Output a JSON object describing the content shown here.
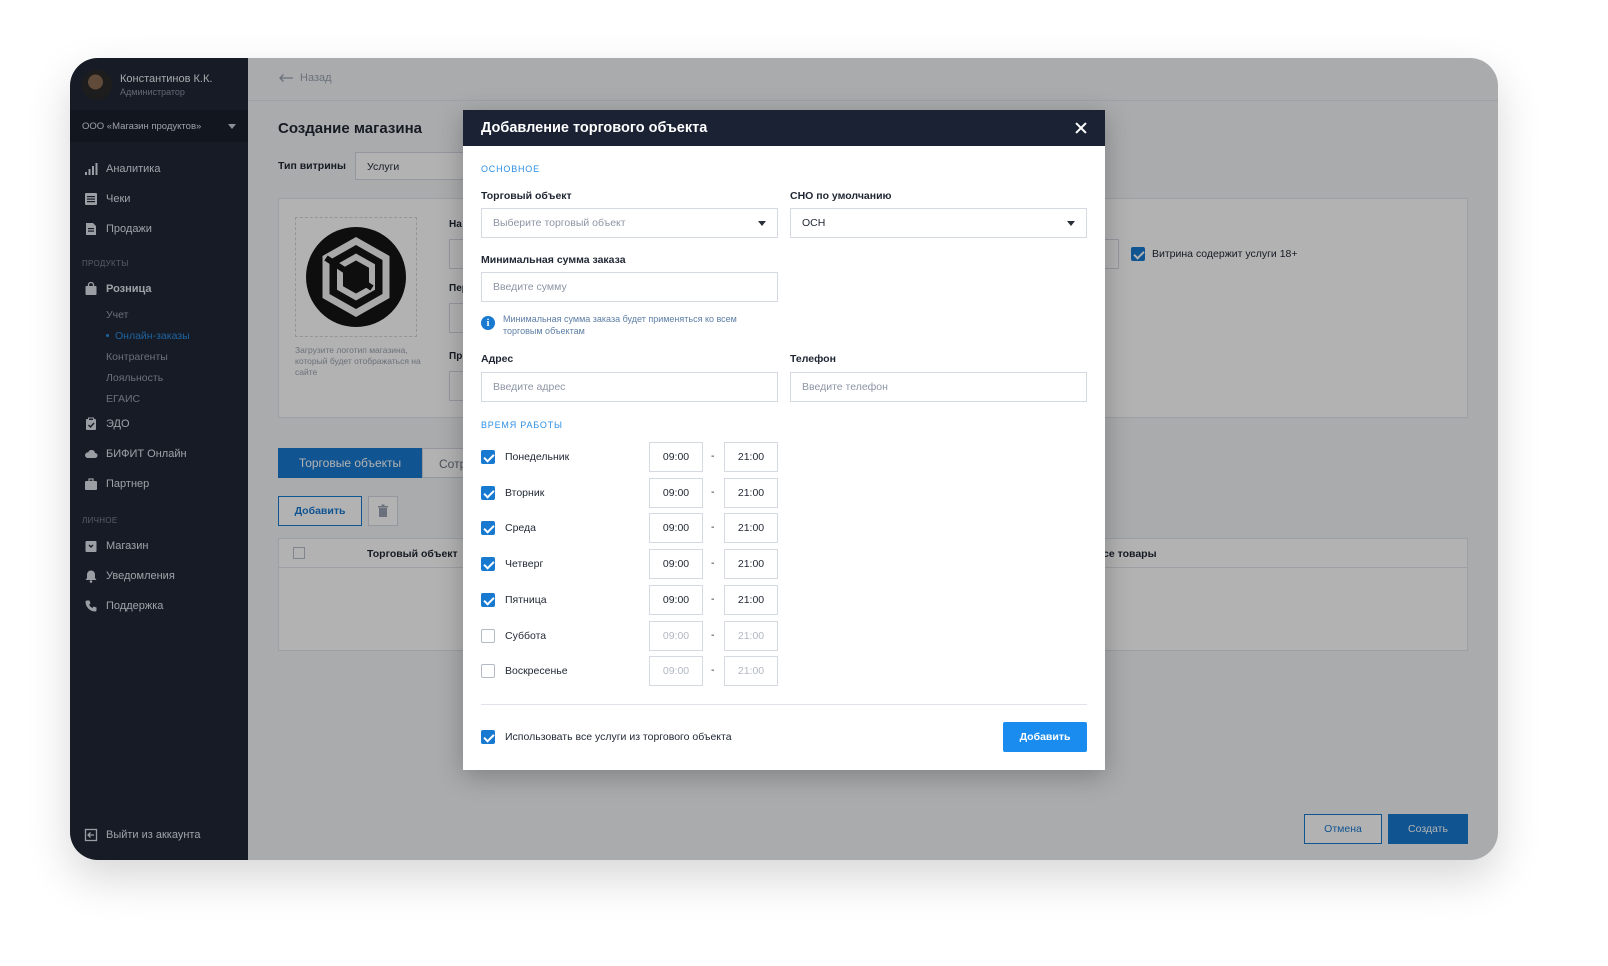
{
  "sidebar": {
    "user_name": "Константинов К.К.",
    "user_role": "Администратор",
    "org": "ООО «Магазин продуктов»",
    "items_top": [
      {
        "label": "Аналитика",
        "icon": "chart-bars-icon"
      },
      {
        "label": "Чеки",
        "icon": "receipt-icon"
      },
      {
        "label": "Продажи",
        "icon": "document-icon"
      }
    ],
    "section_products": "ПРОДУКТЫ",
    "retail": "Розница",
    "retail_sub": [
      "Учет",
      "Онлайн-заказы",
      "Контрагенты",
      "Лояльность",
      "ЕГАИС"
    ],
    "items_mid": [
      {
        "label": "ЭДО",
        "icon": "clipboard-icon"
      },
      {
        "label": "БИФИТ Онлайн",
        "icon": "cloud-icon"
      },
      {
        "label": "Партнер",
        "icon": "briefcase-icon"
      }
    ],
    "section_personal": "ЛИЧНОЕ",
    "items_personal": [
      {
        "label": "Магазин",
        "icon": "store-icon"
      },
      {
        "label": "Уведомления",
        "icon": "bell-icon"
      },
      {
        "label": "Поддержка",
        "icon": "phone-icon"
      }
    ],
    "logout": "Выйти из аккаунта"
  },
  "main": {
    "back": "Назад",
    "title": "Создание магазина",
    "vitrina_label": "Тип витрины",
    "vitrina_value": "Услуги",
    "logo_hint": "Загрузите логотип магазина, который будет отображаться на сайте",
    "frag_labels": [
      "На",
      "Пер",
      "Пр"
    ],
    "age_label": "Витрина содержит услуги 18+",
    "tab_active": "Торговые объекты",
    "tab_2": "Сотр",
    "add_button": "Добавить",
    "col_object": "Торговый объект",
    "col_goods": "се товары",
    "cancel": "Отмена",
    "create": "Создать"
  },
  "modal": {
    "title": "Добавление торгового объекта",
    "section_main": "ОСНОВНОЕ",
    "object_label": "Торговый объект",
    "object_placeholder": "Выберите торговый объект",
    "sno_label": "СНО по умолчанию",
    "sno_value": "ОСН",
    "min_label": "Минимальная сумма заказа",
    "min_placeholder": "Введите сумму",
    "min_hint": "Минимальная сумма заказа будет применяться ко всем торговым объектам",
    "address_label": "Адрес",
    "address_placeholder": "Введите адрес",
    "phone_label": "Телефон",
    "phone_placeholder": "Введите телефон",
    "section_hours": "ВРЕМЯ РАБОТЫ",
    "days": [
      {
        "name": "Понедельник",
        "checked": true,
        "from": "09:00",
        "to": "21:00"
      },
      {
        "name": "Вторник",
        "checked": true,
        "from": "09:00",
        "to": "21:00"
      },
      {
        "name": "Среда",
        "checked": true,
        "from": "09:00",
        "to": "21:00"
      },
      {
        "name": "Четверг",
        "checked": true,
        "from": "09:00",
        "to": "21:00"
      },
      {
        "name": "Пятница",
        "checked": true,
        "from": "09:00",
        "to": "21:00"
      },
      {
        "name": "Суббота",
        "checked": false,
        "from": "09:00",
        "to": "21:00"
      },
      {
        "name": "Воскресенье",
        "checked": false,
        "from": "09:00",
        "to": "21:00"
      }
    ],
    "dash": "-",
    "use_all_label": "Использовать все услуги из торгового объекта",
    "add_button": "Добавить"
  },
  "colors": {
    "accent": "#1879d1",
    "sidebar": "#202737",
    "modal_header": "#1a2234"
  }
}
